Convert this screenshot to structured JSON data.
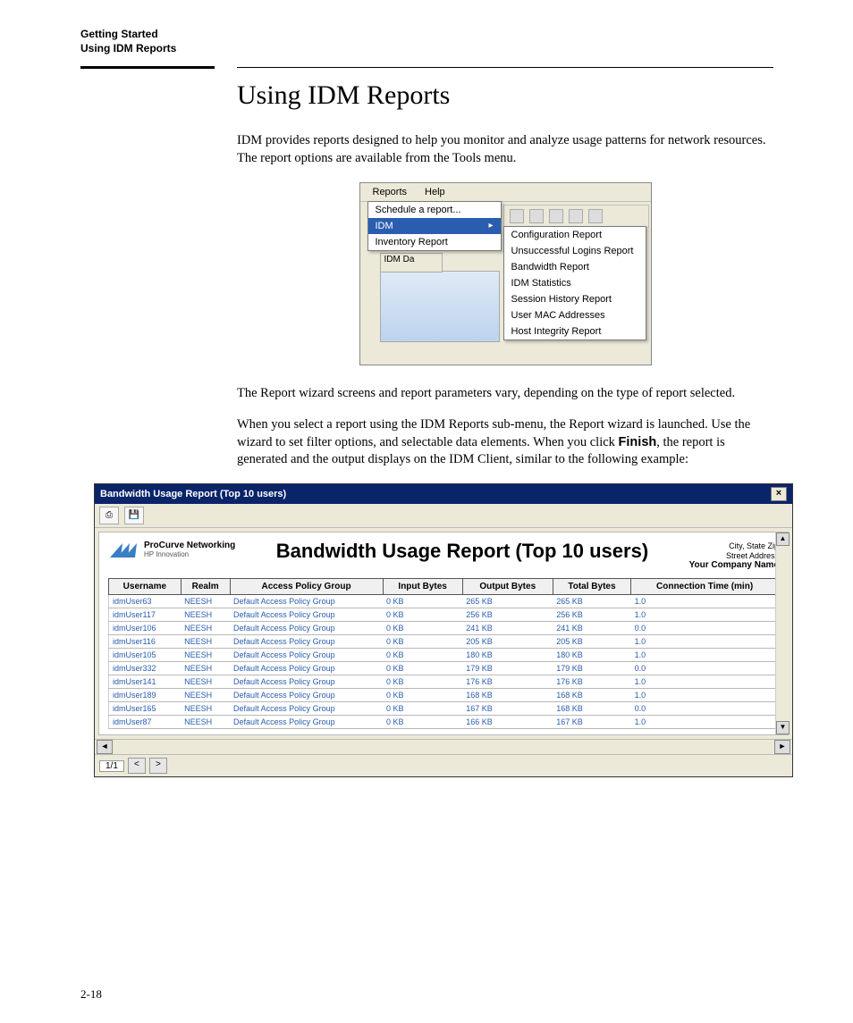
{
  "header": {
    "line1": "Getting Started",
    "line2": "Using IDM Reports"
  },
  "title": "Using IDM Reports",
  "para1": "IDM provides reports designed to help you monitor and analyze usage patterns for network resources. The report options are available from the Tools menu.",
  "para2": "The Report wizard screens and report parameters vary, depending on the type of report selected.",
  "para3a": "When you select a report using the IDM Reports sub-menu, the Report wizard is launched. Use the wizard to set filter options, and selectable data elements. When you click ",
  "para3bold": "Finish",
  "para3b": ", the report is generated and the output displays on the IDM Client, similar to the following example:",
  "menu": {
    "menubar": [
      "Reports",
      "Help"
    ],
    "dropdown1": [
      {
        "label": "Schedule a report...",
        "selected": false
      },
      {
        "label": "IDM",
        "selected": true
      },
      {
        "label": "Inventory Report",
        "selected": false
      }
    ],
    "behindTab": "IDM Da",
    "dropdown2": [
      "Configuration Report",
      "Unsuccessful Logins Report",
      "Bandwidth Report",
      "IDM Statistics",
      "Session History Report",
      "User MAC Addresses",
      "Host Integrity Report"
    ]
  },
  "report": {
    "windowTitle": "Bandwidth Usage Report (Top 10 users)",
    "brandName": "ProCurve Networking",
    "brandSub": "HP Innovation",
    "title": "Bandwidth Usage Report (Top 10 users)",
    "addr1": "City, State Zip",
    "addr2": "Street Address",
    "addr3": "Your Company Name",
    "columns": [
      "Username",
      "Realm",
      "Access Policy Group",
      "Input Bytes",
      "Output Bytes",
      "Total Bytes",
      "Connection Time (min)"
    ],
    "rows": [
      [
        "idmUser63",
        "NEESH",
        "Default Access Policy Group",
        "0 KB",
        "265 KB",
        "265 KB",
        "1.0"
      ],
      [
        "idmUser117",
        "NEESH",
        "Default Access Policy Group",
        "0 KB",
        "256 KB",
        "256 KB",
        "1.0"
      ],
      [
        "idmUser106",
        "NEESH",
        "Default Access Policy Group",
        "0 KB",
        "241 KB",
        "241 KB",
        "0.0"
      ],
      [
        "idmUser116",
        "NEESH",
        "Default Access Policy Group",
        "0 KB",
        "205 KB",
        "205 KB",
        "1.0"
      ],
      [
        "idmUser105",
        "NEESH",
        "Default Access Policy Group",
        "0 KB",
        "180 KB",
        "180 KB",
        "1.0"
      ],
      [
        "idmUser332",
        "NEESH",
        "Default Access Policy Group",
        "0 KB",
        "179 KB",
        "179 KB",
        "0.0"
      ],
      [
        "idmUser141",
        "NEESH",
        "Default Access Policy Group",
        "0 KB",
        "176 KB",
        "176 KB",
        "1.0"
      ],
      [
        "idmUser189",
        "NEESH",
        "Default Access Policy Group",
        "0 KB",
        "168 KB",
        "168 KB",
        "1.0"
      ],
      [
        "idmUser165",
        "NEESH",
        "Default Access Policy Group",
        "0 KB",
        "167 KB",
        "168 KB",
        "0.0"
      ],
      [
        "idmUser87",
        "NEESH",
        "Default Access Policy Group",
        "0 KB",
        "166 KB",
        "167 KB",
        "1.0"
      ]
    ],
    "page": "1/1"
  },
  "pageNumber": "2-18"
}
